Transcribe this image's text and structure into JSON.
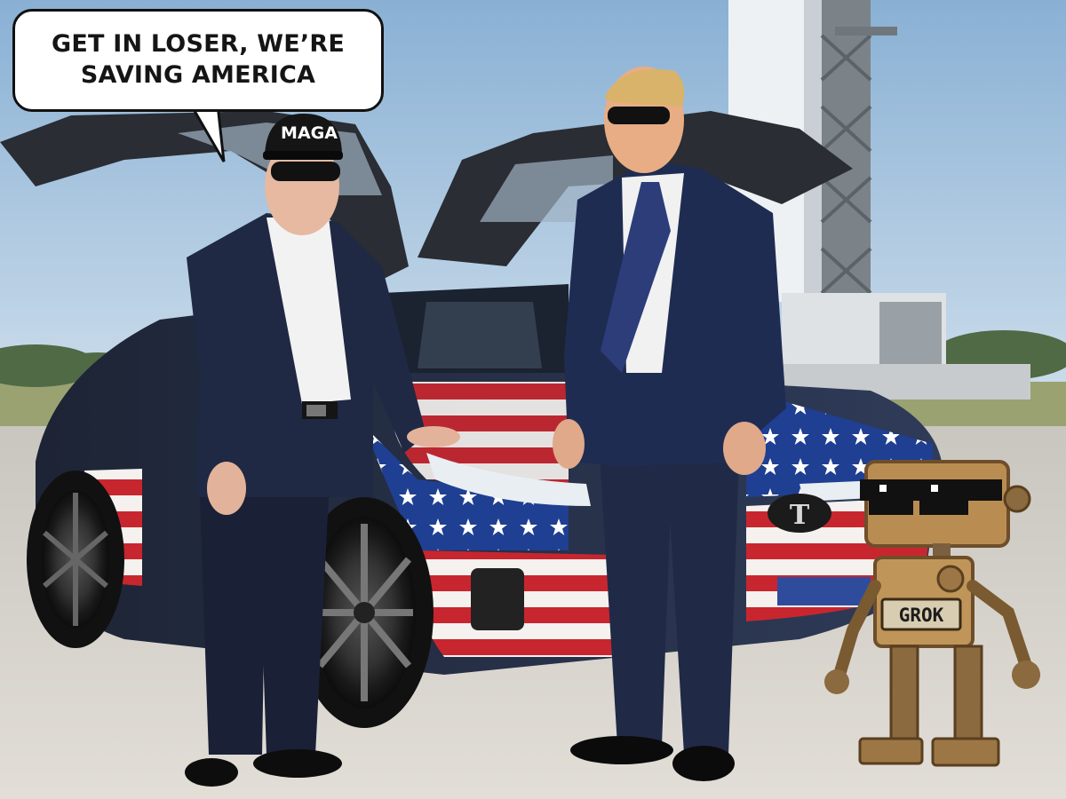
{
  "speech_bubble": {
    "line1": "GET IN LOSER, WE’RE",
    "line2": "SAVING AMERICA"
  },
  "hat_text": "MAGA",
  "car_badge": "T",
  "robot_label": "GROK",
  "colors": {
    "sky_top": "#8fb6d8",
    "sky_bottom": "#c9dcea",
    "tarmac": "#d7d3cc",
    "suit_navy": "#1c2540",
    "flag_red": "#c8262f",
    "flag_blue": "#1f3f92",
    "robot_brass": "#b98d52"
  }
}
